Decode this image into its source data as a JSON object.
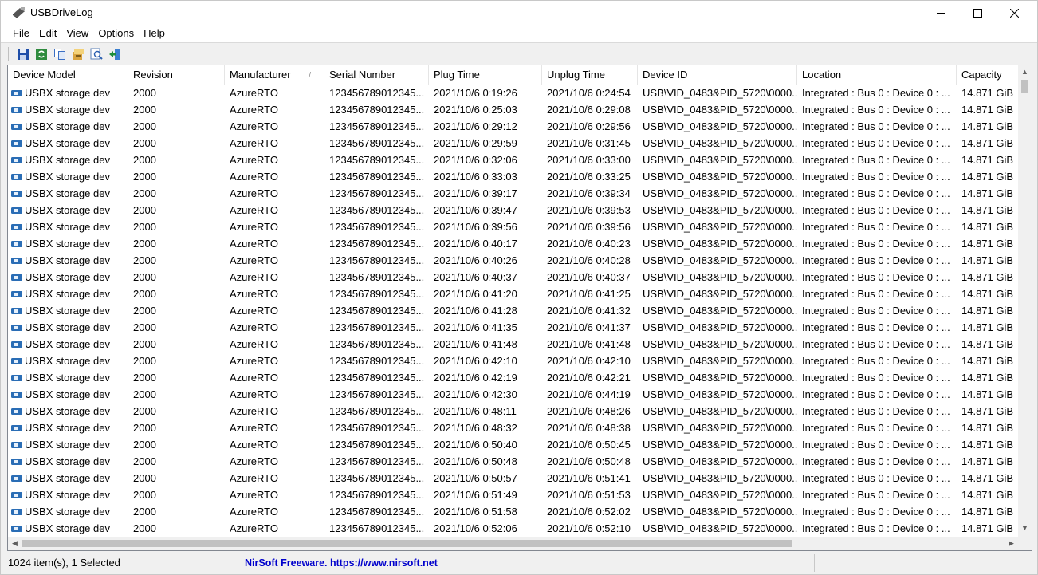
{
  "window": {
    "title": "USBDriveLog"
  },
  "menu": [
    "File",
    "Edit",
    "View",
    "Options",
    "Help"
  ],
  "toolbar": {
    "buttons": [
      "save-icon",
      "refresh-icon",
      "copy-icon",
      "properties-icon",
      "find-icon",
      "exit-icon"
    ]
  },
  "table": {
    "columns": [
      "Device Model",
      "Revision",
      "Manufacturer",
      "Serial Number",
      "Plug Time",
      "Unplug Time",
      "Device ID",
      "Location",
      "Capacity"
    ],
    "sorted_column": "Manufacturer",
    "rows": [
      [
        "USBX storage dev",
        "2000",
        "AzureRTO",
        "123456789012345...",
        "2021/10/6 0:19:26",
        "2021/10/6 0:24:54",
        "USB\\VID_0483&PID_5720\\0000...",
        "Integrated : Bus 0 : Device 0 : ...",
        "14.871 GiB"
      ],
      [
        "USBX storage dev",
        "2000",
        "AzureRTO",
        "123456789012345...",
        "2021/10/6 0:25:03",
        "2021/10/6 0:29:08",
        "USB\\VID_0483&PID_5720\\0000...",
        "Integrated : Bus 0 : Device 0 : ...",
        "14.871 GiB"
      ],
      [
        "USBX storage dev",
        "2000",
        "AzureRTO",
        "123456789012345...",
        "2021/10/6 0:29:12",
        "2021/10/6 0:29:56",
        "USB\\VID_0483&PID_5720\\0000...",
        "Integrated : Bus 0 : Device 0 : ...",
        "14.871 GiB"
      ],
      [
        "USBX storage dev",
        "2000",
        "AzureRTO",
        "123456789012345...",
        "2021/10/6 0:29:59",
        "2021/10/6 0:31:45",
        "USB\\VID_0483&PID_5720\\0000...",
        "Integrated : Bus 0 : Device 0 : ...",
        "14.871 GiB"
      ],
      [
        "USBX storage dev",
        "2000",
        "AzureRTO",
        "123456789012345...",
        "2021/10/6 0:32:06",
        "2021/10/6 0:33:00",
        "USB\\VID_0483&PID_5720\\0000...",
        "Integrated : Bus 0 : Device 0 : ...",
        "14.871 GiB"
      ],
      [
        "USBX storage dev",
        "2000",
        "AzureRTO",
        "123456789012345...",
        "2021/10/6 0:33:03",
        "2021/10/6 0:33:25",
        "USB\\VID_0483&PID_5720\\0000...",
        "Integrated : Bus 0 : Device 0 : ...",
        "14.871 GiB"
      ],
      [
        "USBX storage dev",
        "2000",
        "AzureRTO",
        "123456789012345...",
        "2021/10/6 0:39:17",
        "2021/10/6 0:39:34",
        "USB\\VID_0483&PID_5720\\0000...",
        "Integrated : Bus 0 : Device 0 : ...",
        "14.871 GiB"
      ],
      [
        "USBX storage dev",
        "2000",
        "AzureRTO",
        "123456789012345...",
        "2021/10/6 0:39:47",
        "2021/10/6 0:39:53",
        "USB\\VID_0483&PID_5720\\0000...",
        "Integrated : Bus 0 : Device 0 : ...",
        "14.871 GiB"
      ],
      [
        "USBX storage dev",
        "2000",
        "AzureRTO",
        "123456789012345...",
        "2021/10/6 0:39:56",
        "2021/10/6 0:39:56",
        "USB\\VID_0483&PID_5720\\0000...",
        "Integrated : Bus 0 : Device 0 : ...",
        "14.871 GiB"
      ],
      [
        "USBX storage dev",
        "2000",
        "AzureRTO",
        "123456789012345...",
        "2021/10/6 0:40:17",
        "2021/10/6 0:40:23",
        "USB\\VID_0483&PID_5720\\0000...",
        "Integrated : Bus 0 : Device 0 : ...",
        "14.871 GiB"
      ],
      [
        "USBX storage dev",
        "2000",
        "AzureRTO",
        "123456789012345...",
        "2021/10/6 0:40:26",
        "2021/10/6 0:40:28",
        "USB\\VID_0483&PID_5720\\0000...",
        "Integrated : Bus 0 : Device 0 : ...",
        "14.871 GiB"
      ],
      [
        "USBX storage dev",
        "2000",
        "AzureRTO",
        "123456789012345...",
        "2021/10/6 0:40:37",
        "2021/10/6 0:40:37",
        "USB\\VID_0483&PID_5720\\0000...",
        "Integrated : Bus 0 : Device 0 : ...",
        "14.871 GiB"
      ],
      [
        "USBX storage dev",
        "2000",
        "AzureRTO",
        "123456789012345...",
        "2021/10/6 0:41:20",
        "2021/10/6 0:41:25",
        "USB\\VID_0483&PID_5720\\0000...",
        "Integrated : Bus 0 : Device 0 : ...",
        "14.871 GiB"
      ],
      [
        "USBX storage dev",
        "2000",
        "AzureRTO",
        "123456789012345...",
        "2021/10/6 0:41:28",
        "2021/10/6 0:41:32",
        "USB\\VID_0483&PID_5720\\0000...",
        "Integrated : Bus 0 : Device 0 : ...",
        "14.871 GiB"
      ],
      [
        "USBX storage dev",
        "2000",
        "AzureRTO",
        "123456789012345...",
        "2021/10/6 0:41:35",
        "2021/10/6 0:41:37",
        "USB\\VID_0483&PID_5720\\0000...",
        "Integrated : Bus 0 : Device 0 : ...",
        "14.871 GiB"
      ],
      [
        "USBX storage dev",
        "2000",
        "AzureRTO",
        "123456789012345...",
        "2021/10/6 0:41:48",
        "2021/10/6 0:41:48",
        "USB\\VID_0483&PID_5720\\0000...",
        "Integrated : Bus 0 : Device 0 : ...",
        "14.871 GiB"
      ],
      [
        "USBX storage dev",
        "2000",
        "AzureRTO",
        "123456789012345...",
        "2021/10/6 0:42:10",
        "2021/10/6 0:42:10",
        "USB\\VID_0483&PID_5720\\0000...",
        "Integrated : Bus 0 : Device 0 : ...",
        "14.871 GiB"
      ],
      [
        "USBX storage dev",
        "2000",
        "AzureRTO",
        "123456789012345...",
        "2021/10/6 0:42:19",
        "2021/10/6 0:42:21",
        "USB\\VID_0483&PID_5720\\0000...",
        "Integrated : Bus 0 : Device 0 : ...",
        "14.871 GiB"
      ],
      [
        "USBX storage dev",
        "2000",
        "AzureRTO",
        "123456789012345...",
        "2021/10/6 0:42:30",
        "2021/10/6 0:44:19",
        "USB\\VID_0483&PID_5720\\0000...",
        "Integrated : Bus 0 : Device 0 : ...",
        "14.871 GiB"
      ],
      [
        "USBX storage dev",
        "2000",
        "AzureRTO",
        "123456789012345...",
        "2021/10/6 0:48:11",
        "2021/10/6 0:48:26",
        "USB\\VID_0483&PID_5720\\0000...",
        "Integrated : Bus 0 : Device 0 : ...",
        "14.871 GiB"
      ],
      [
        "USBX storage dev",
        "2000",
        "AzureRTO",
        "123456789012345...",
        "2021/10/6 0:48:32",
        "2021/10/6 0:48:38",
        "USB\\VID_0483&PID_5720\\0000...",
        "Integrated : Bus 0 : Device 0 : ...",
        "14.871 GiB"
      ],
      [
        "USBX storage dev",
        "2000",
        "AzureRTO",
        "123456789012345...",
        "2021/10/6 0:50:40",
        "2021/10/6 0:50:45",
        "USB\\VID_0483&PID_5720\\0000...",
        "Integrated : Bus 0 : Device 0 : ...",
        "14.871 GiB"
      ],
      [
        "USBX storage dev",
        "2000",
        "AzureRTO",
        "123456789012345...",
        "2021/10/6 0:50:48",
        "2021/10/6 0:50:48",
        "USB\\VID_0483&PID_5720\\0000...",
        "Integrated : Bus 0 : Device 0 : ...",
        "14.871 GiB"
      ],
      [
        "USBX storage dev",
        "2000",
        "AzureRTO",
        "123456789012345...",
        "2021/10/6 0:50:57",
        "2021/10/6 0:51:41",
        "USB\\VID_0483&PID_5720\\0000...",
        "Integrated : Bus 0 : Device 0 : ...",
        "14.871 GiB"
      ],
      [
        "USBX storage dev",
        "2000",
        "AzureRTO",
        "123456789012345...",
        "2021/10/6 0:51:49",
        "2021/10/6 0:51:53",
        "USB\\VID_0483&PID_5720\\0000...",
        "Integrated : Bus 0 : Device 0 : ...",
        "14.871 GiB"
      ],
      [
        "USBX storage dev",
        "2000",
        "AzureRTO",
        "123456789012345...",
        "2021/10/6 0:51:58",
        "2021/10/6 0:52:02",
        "USB\\VID_0483&PID_5720\\0000...",
        "Integrated : Bus 0 : Device 0 : ...",
        "14.871 GiB"
      ],
      [
        "USBX storage dev",
        "2000",
        "AzureRTO",
        "123456789012345...",
        "2021/10/6 0:52:06",
        "2021/10/6 0:52:10",
        "USB\\VID_0483&PID_5720\\0000...",
        "Integrated : Bus 0 : Device 0 : ...",
        "14.871 GiB"
      ]
    ]
  },
  "statusbar": {
    "count": "1024 item(s), 1 Selected",
    "link": "NirSoft Freeware. https://www.nirsoft.net"
  },
  "colors": {
    "link": "#0000cc",
    "row_icon": "#2a6db5"
  }
}
